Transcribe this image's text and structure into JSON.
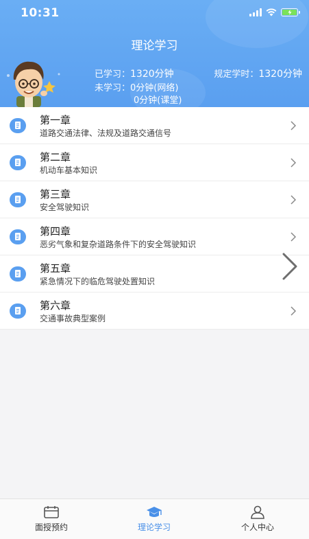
{
  "status_bar": {
    "time": "10:31"
  },
  "header": {
    "title": "理论学习",
    "learned_label": "已学习：",
    "learned_value": "1320分钟",
    "required_label": "规定学时：",
    "required_value": "1320分钟",
    "unlearned_label": "未学习：",
    "unlearned_network": "0分钟(网络)",
    "unlearned_classroom": "0分钟(课堂)"
  },
  "chapters": [
    {
      "title": "第一章",
      "subtitle": "道路交通法律、法规及道路交通信号"
    },
    {
      "title": "第二章",
      "subtitle": "机动车基本知识"
    },
    {
      "title": "第三章",
      "subtitle": "安全驾驶知识"
    },
    {
      "title": "第四章",
      "subtitle": "恶劣气象和复杂道路条件下的安全驾驶知识"
    },
    {
      "title": "第五章",
      "subtitle": "紧急情况下的临危驾驶处置知识"
    },
    {
      "title": "第六章",
      "subtitle": "交通事故典型案例"
    }
  ],
  "tabbar": {
    "items": [
      {
        "label": "面授预约",
        "icon": "calendar-icon"
      },
      {
        "label": "理论学习",
        "icon": "graduation-cap-icon",
        "active": true
      },
      {
        "label": "个人中心",
        "icon": "person-icon"
      }
    ]
  },
  "colors": {
    "header_bg": "#5a9ff0",
    "accent": "#4a90e8",
    "battery": "#7be25a"
  }
}
